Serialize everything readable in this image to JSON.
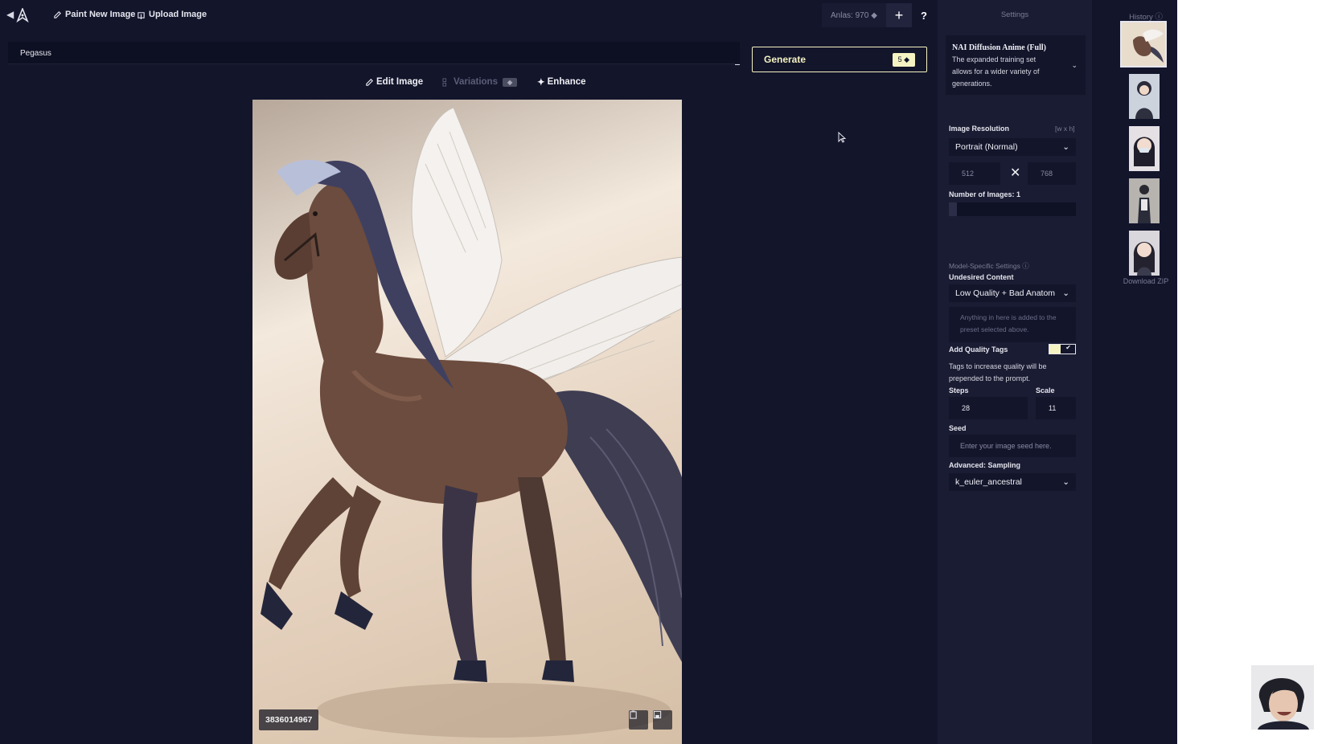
{
  "toolbar": {
    "paint_label": "Paint New Image",
    "upload_label": "Upload Image",
    "anlas_label": "Anlas: 970",
    "plus_label": "+",
    "help_label": "?"
  },
  "prompt": {
    "value": "Pegasus"
  },
  "generate": {
    "label": "Generate",
    "cost": "5"
  },
  "edit_tabs": [
    {
      "label": "Edit Image",
      "enabled": true
    },
    {
      "label": "Variations",
      "enabled": false
    },
    {
      "label": "Enhance",
      "enabled": true
    }
  ],
  "image": {
    "seed": "3836014967"
  },
  "settings": {
    "heading": "Settings",
    "model": {
      "name": "NAI Diffusion Anime (Full)",
      "description": "The expanded training set allows for a wider variety of generations."
    },
    "resolution": {
      "label": "Image Resolution",
      "hint": "[w x h]",
      "preset": "Portrait (Normal)",
      "width": "512",
      "height": "768"
    },
    "num_images": {
      "label": "Number of Images:",
      "value": "1"
    },
    "model_specific_label": "Model-Specific Settings",
    "undesired": {
      "label": "Undesired Content",
      "preset": "Low Quality + Bad Anatom",
      "placeholder": "Anything in here is added to the preset selected above."
    },
    "quality_tags": {
      "label": "Add Quality Tags",
      "enabled": true,
      "description": "Tags to increase quality will be prepended to the prompt."
    },
    "steps": {
      "label": "Steps",
      "value": "28"
    },
    "scale": {
      "label": "Scale",
      "value": "11"
    },
    "seed": {
      "label": "Seed",
      "placeholder": "Enter your image seed here."
    },
    "sampling": {
      "label": "Advanced: Sampling",
      "value": "k_euler_ancestral"
    }
  },
  "history": {
    "heading": "History",
    "download_label": "Download ZIP",
    "thumbnails": [
      "pegasus",
      "anime-character",
      "anime-character-mask",
      "anime-character-standing",
      "anime-character-portrait"
    ]
  },
  "colors": {
    "app_bg": "#13152b",
    "panel_bg": "#1a1c33",
    "accent": "#f5f3c2"
  }
}
